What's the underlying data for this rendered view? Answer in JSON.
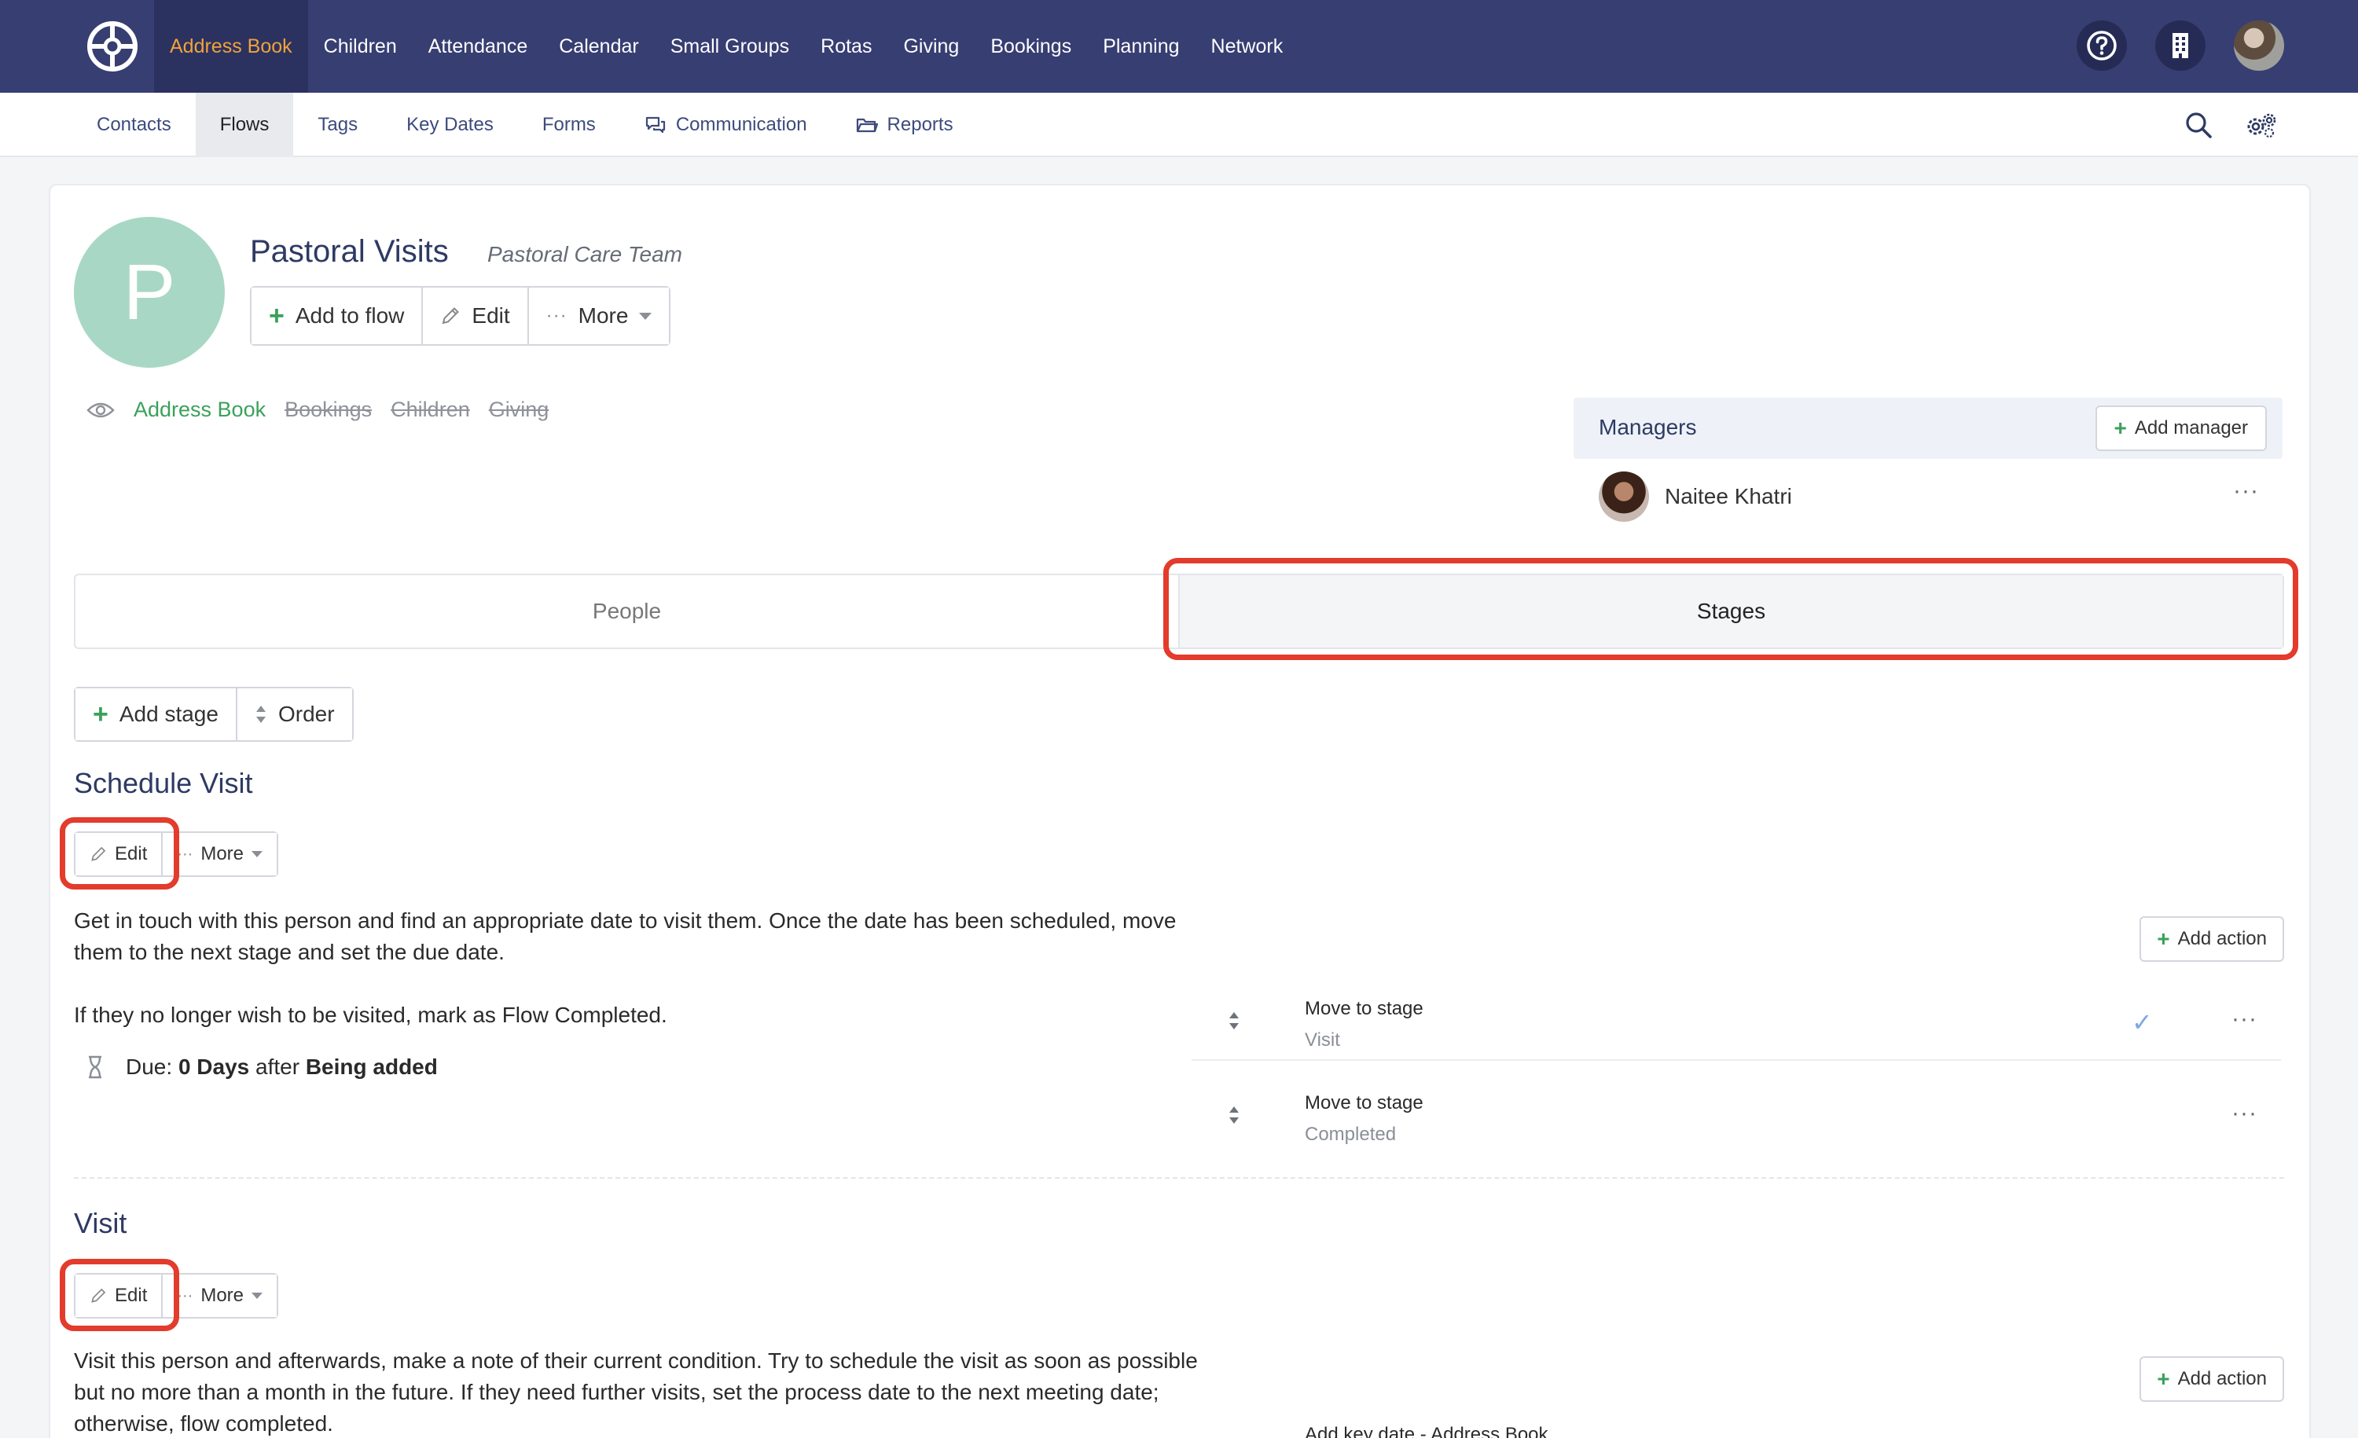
{
  "topnav": {
    "items": [
      "Address Book",
      "Children",
      "Attendance",
      "Calendar",
      "Small Groups",
      "Rotas",
      "Giving",
      "Bookings",
      "Planning",
      "Network"
    ],
    "active": "Address Book",
    "icons": [
      "help-icon",
      "building-icon",
      "user-avatar"
    ]
  },
  "subnav": {
    "items": [
      "Contacts",
      "Flows",
      "Tags",
      "Key Dates",
      "Forms",
      "Communication",
      "Reports"
    ],
    "active": "Flows",
    "icons": [
      "search-icon",
      "settings-icon"
    ]
  },
  "flow": {
    "initial": "P",
    "title": "Pastoral Visits",
    "team": "Pastoral Care Team",
    "actions": {
      "add": "Add to flow",
      "edit": "Edit",
      "more": "More"
    },
    "visibility": {
      "enabled": [
        "Address Book"
      ],
      "disabled": [
        "Bookings",
        "Children",
        "Giving"
      ]
    }
  },
  "managers": {
    "title": "Managers",
    "add_label": "Add manager",
    "list": [
      {
        "name": "Naitee Khatri"
      }
    ]
  },
  "tabs": {
    "people": "People",
    "stages": "Stages",
    "active": "Stages"
  },
  "stage_toolbar": {
    "add": "Add stage",
    "order": "Order"
  },
  "stages": [
    {
      "title": "Schedule Visit",
      "edit": "Edit",
      "more": "More",
      "description_1": "Get in touch with this person and find an appropriate date to visit them. Once the date has been scheduled, move them to the next stage and set the due date.",
      "description_2": "If they no longer wish to be visited, mark as Flow Completed.",
      "due": {
        "prefix": "Due:",
        "amount": "0 Days",
        "relation": "after",
        "event": "Being added"
      },
      "add_action": "Add action",
      "actions": [
        {
          "label": "Move to stage",
          "value": "Visit"
        },
        {
          "label": "Move to stage",
          "value": "Completed"
        }
      ]
    },
    {
      "title": "Visit",
      "edit": "Edit",
      "more": "More",
      "description_1": "Visit this person and afterwards, make a note of their current condition. Try to schedule the visit as soon as possible but no more than a month in the future. If they need further visits, set the process date to the next meeting date; otherwise, flow completed.",
      "add_action": "Add action",
      "actions": [
        {
          "label": "Add key date - Address Book"
        }
      ]
    }
  ],
  "colors": {
    "topnav_bg": "#373e72",
    "active_nav_text": "#f1a23a",
    "highlight": "#e33b2c",
    "enabled_green": "#3aa15b",
    "avatar_bg": "#a8d8c5"
  }
}
